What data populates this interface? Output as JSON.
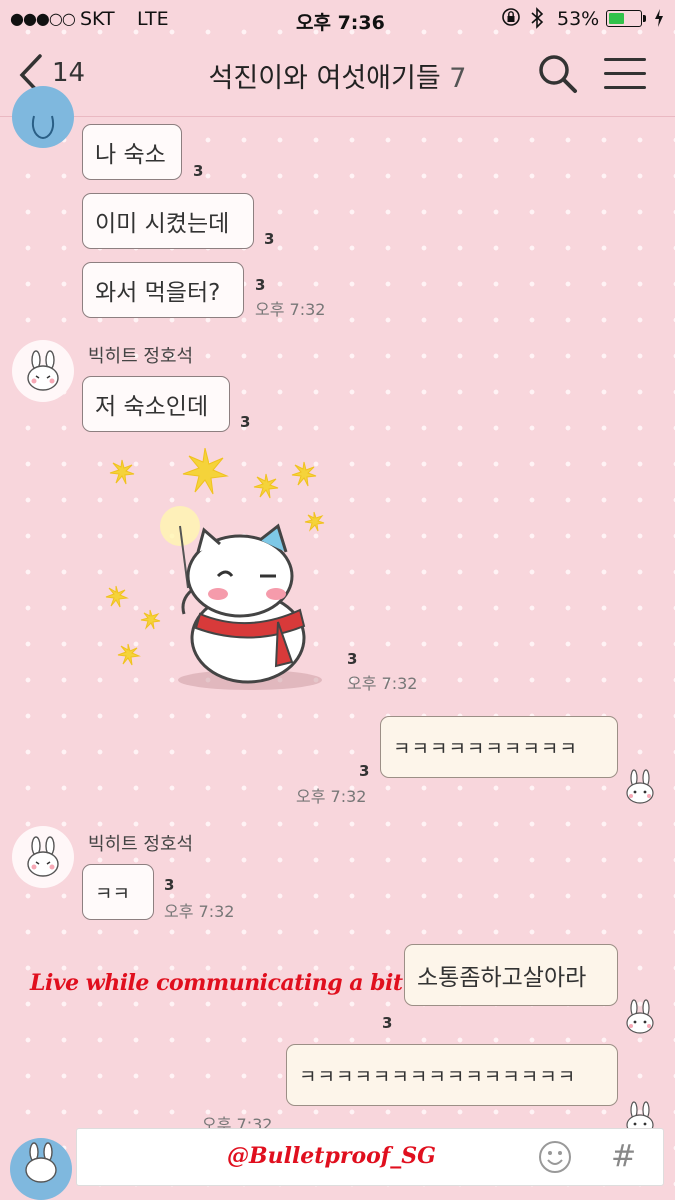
{
  "status_bar": {
    "carrier": "SKT",
    "network": "LTE",
    "time": "오후 7:36",
    "battery": "53%",
    "battery_level": 0.53
  },
  "header": {
    "back_count": "14",
    "title": "석진이와 여섯애기들",
    "member_count": "7"
  },
  "messages": {
    "m1": {
      "text": "나 숙소",
      "unread": "3"
    },
    "m2": {
      "text": "이미 시켰는데",
      "unread": "3"
    },
    "m3": {
      "text": "와서 먹을터?",
      "unread": "3",
      "time": "오후 7:32"
    },
    "sender2": "빅히트 정호석",
    "m4": {
      "text": "저 숙소인데",
      "unread": "3"
    },
    "sticker": {
      "unread": "3",
      "time": "오후 7:32"
    },
    "m5": {
      "text": "ㅋㅋㅋㅋㅋㅋㅋㅋㅋㅋ",
      "unread": "3",
      "time": "오후 7:32"
    },
    "sender3": "빅히트 정호석",
    "m6": {
      "text": "ㅋㅋ",
      "unread": "3",
      "time": "오후 7:32"
    },
    "m7": {
      "text": "소통좀하고살아라",
      "unread": "3"
    },
    "m8": {
      "text": "ㅋㅋㅋㅋㅋㅋㅋㅋㅋㅋㅋㅋㅋㅋㅋ",
      "time": "오후 7:32"
    }
  },
  "caption": "Live while communicating a bit",
  "input_bar": {
    "watermark": "@Bulletproof_SG",
    "hash_label": "#"
  },
  "icons": {
    "back": "chevron-left-icon",
    "search": "search-icon",
    "menu": "hamburger-menu-icon",
    "emoji": "emoji-icon"
  },
  "colors": {
    "background": "#f8d6dc",
    "caption": "#e00f1e",
    "battery": "#31c24a"
  }
}
